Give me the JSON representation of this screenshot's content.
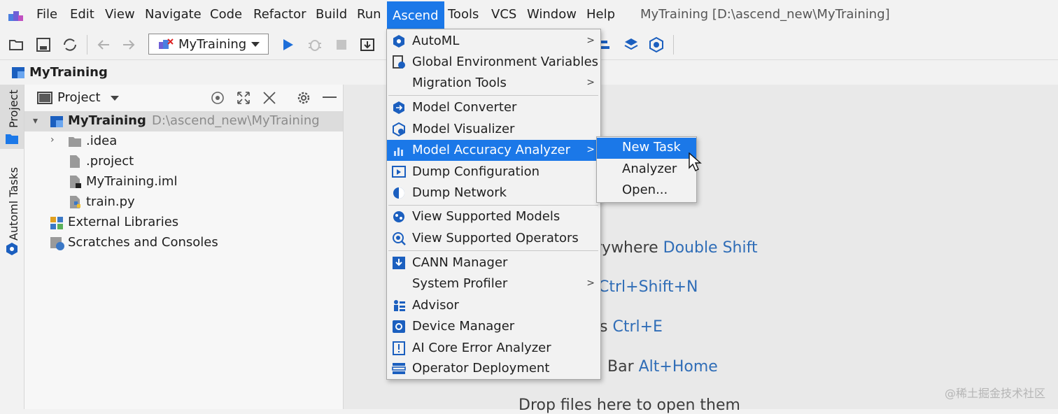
{
  "menubar": {
    "items": [
      "File",
      "Edit",
      "View",
      "Navigate",
      "Code",
      "Refactor",
      "Build",
      "Run",
      "Ascend",
      "Tools",
      "VCS",
      "Window",
      "Help"
    ],
    "active": "Ascend",
    "window_title": "MyTraining [D:\\ascend_new\\MyTraining]"
  },
  "toolbar": {
    "run_config": "MyTraining"
  },
  "breadcrumb": {
    "label": "MyTraining"
  },
  "tool_stripe": {
    "project_tab": "Project",
    "automl_tab": "Automl Tasks"
  },
  "project_panel": {
    "title": "Project",
    "tree": [
      {
        "label": "MyTraining",
        "path": "D:\\ascend_new\\MyTraining",
        "icon": "module-icon",
        "selected": true
      },
      {
        "label": ".idea",
        "icon": "folder-icon"
      },
      {
        "label": ".project",
        "icon": "file-icon"
      },
      {
        "label": "MyTraining.iml",
        "icon": "iml-file-icon"
      },
      {
        "label": "train.py",
        "icon": "python-file-icon"
      },
      {
        "label": "External Libraries",
        "icon": "libraries-icon"
      },
      {
        "label": "Scratches and Consoles",
        "icon": "scratches-icon"
      }
    ]
  },
  "ascend_menu": {
    "items": [
      {
        "label": "AutoML",
        "icon": "automl-icon",
        "submenu": true
      },
      {
        "label": "Global Environment Variables",
        "icon": "env-vars-icon"
      },
      {
        "label": "Migration Tools",
        "submenu": true
      },
      {
        "label": "Model Converter",
        "icon": "model-converter-icon"
      },
      {
        "label": "Model Visualizer",
        "icon": "model-visualizer-icon"
      },
      {
        "label": "Model Accuracy Analyzer",
        "icon": "accuracy-analyzer-icon",
        "submenu": true,
        "highlighted": true
      },
      {
        "label": "Dump Configuration",
        "icon": "dump-config-icon"
      },
      {
        "label": "Dump Network",
        "icon": "dump-network-icon"
      },
      {
        "label": "View Supported Models",
        "icon": "supported-models-icon"
      },
      {
        "label": "View Supported Operators",
        "icon": "supported-operators-icon"
      },
      {
        "label": "CANN Manager",
        "icon": "cann-manager-icon"
      },
      {
        "label": "System Profiler",
        "submenu": true
      },
      {
        "label": "Advisor",
        "icon": "advisor-icon"
      },
      {
        "label": "Device Manager",
        "icon": "device-manager-icon"
      },
      {
        "label": "AI Core Error Analyzer",
        "icon": "error-analyzer-icon"
      },
      {
        "label": "Operator Deployment",
        "icon": "operator-deployment-icon"
      }
    ]
  },
  "submenu": {
    "items": [
      "New Task",
      "Analyzer",
      "Open..."
    ],
    "highlighted": "New Task"
  },
  "editor_hints": [
    {
      "text": "rywhere ",
      "key": "Double Shift"
    },
    {
      "text": "",
      "key": "Ctrl+Shift+N"
    },
    {
      "text": "s ",
      "key": "Ctrl+E"
    },
    {
      "text": "Bar ",
      "key": "Alt+Home"
    },
    {
      "text": "Drop files here to open them",
      "key": ""
    }
  ],
  "watermark": "@稀土掘金技术社区",
  "colors": {
    "accent": "#1b78e8",
    "key_text": "#2f6db7",
    "run_green": "#1e6fd9"
  }
}
